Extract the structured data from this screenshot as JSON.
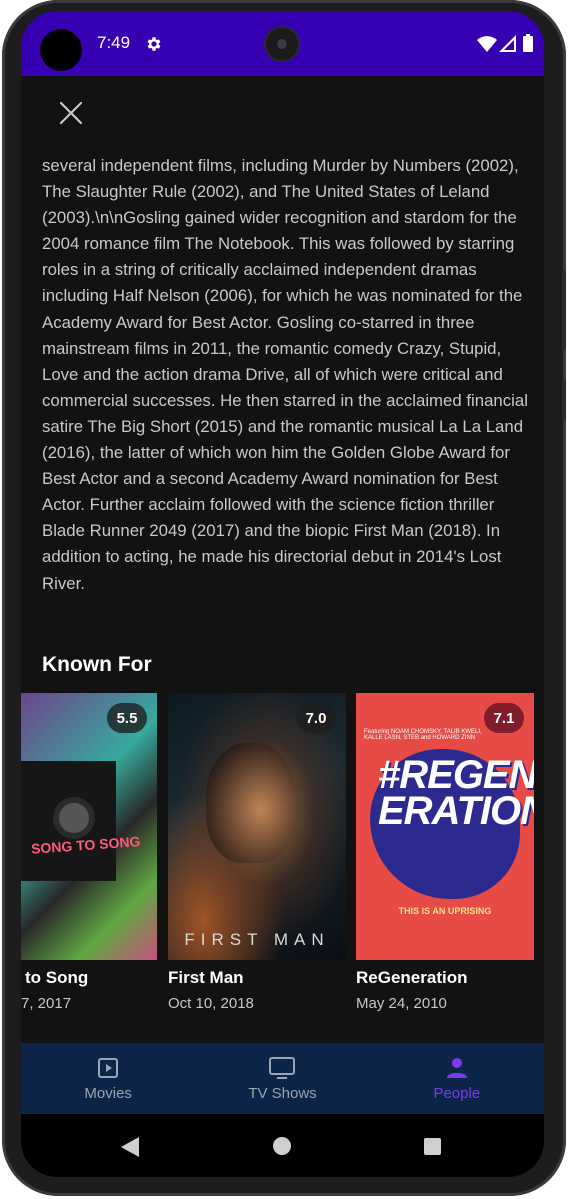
{
  "status_bar": {
    "time": "7:49"
  },
  "biography": "several independent films, including Murder by Numbers (2002), The Slaughter Rule (2002), and The United States of Leland (2003).\\n\\nGosling gained wider recognition and stardom for the 2004 romance film The Notebook. This was followed by starring roles in a string of critically acclaimed independent dramas including Half Nelson (2006), for which he was nominated for the Academy Award for Best Actor. Gosling co-starred in three mainstream films in 2011, the romantic comedy Crazy, Stupid, Love and the action drama Drive, all of which were critical and commercial successes. He then starred in the acclaimed financial satire The Big Short (2015) and the romantic musical La La Land (2016), the latter of which won him the Golden Globe Award for Best Actor and a second Academy Award nomination for Best Actor. Further acclaim followed with the science fiction thriller Blade Runner 2049 (2017) and the biopic First Man (2018). In addition to acting, he made his directorial debut in 2014's Lost River.",
  "known_for": {
    "title": "Known For",
    "items": [
      {
        "title": "to Song",
        "date": "7, 2017",
        "rating": "5.5",
        "poster_text": "SONG TO SONG"
      },
      {
        "title": "First Man",
        "date": "Oct 10, 2018",
        "rating": "7.0",
        "poster_text": "FIRST MAN"
      },
      {
        "title": "ReGeneration",
        "date": "May 24, 2010",
        "rating": "7.1",
        "poster_text": "#REGEN ERATION",
        "poster_tagline": "THIS IS AN UPRISING",
        "poster_credit": "Featuring NOAM CHOMSKY, TALIB KWELI, KALLE LASN, STEB and HOWARD ZINN"
      }
    ]
  },
  "bottom_nav": {
    "items": [
      {
        "label": "Movies",
        "icon": "movie-icon"
      },
      {
        "label": "TV Shows",
        "icon": "tv-icon"
      },
      {
        "label": "People",
        "icon": "person-icon",
        "active": true
      }
    ]
  },
  "colors": {
    "status_bar": "#3700b3",
    "background": "#121212",
    "bottom_nav": "#0b2447",
    "active_nav": "#7c3aed"
  }
}
